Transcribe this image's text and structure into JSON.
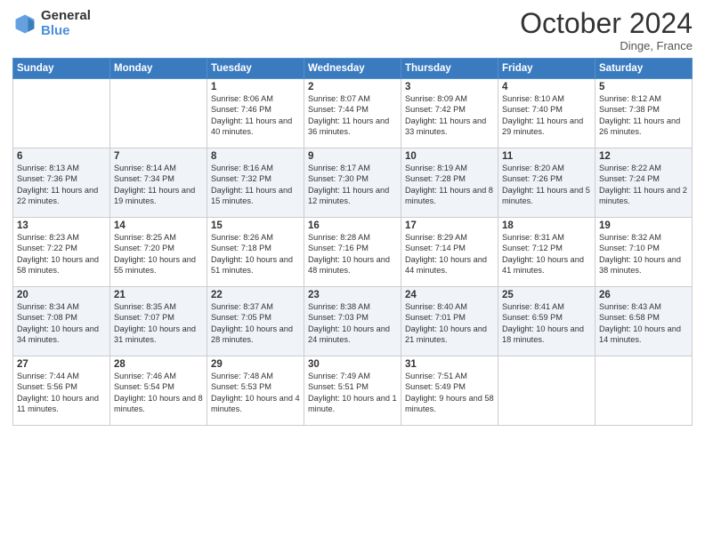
{
  "header": {
    "logo_general": "General",
    "logo_blue": "Blue",
    "month": "October 2024",
    "location": "Dinge, France"
  },
  "weekdays": [
    "Sunday",
    "Monday",
    "Tuesday",
    "Wednesday",
    "Thursday",
    "Friday",
    "Saturday"
  ],
  "weeks": [
    [
      {
        "day": "",
        "info": ""
      },
      {
        "day": "",
        "info": ""
      },
      {
        "day": "1",
        "info": "Sunrise: 8:06 AM\nSunset: 7:46 PM\nDaylight: 11 hours and 40 minutes."
      },
      {
        "day": "2",
        "info": "Sunrise: 8:07 AM\nSunset: 7:44 PM\nDaylight: 11 hours and 36 minutes."
      },
      {
        "day": "3",
        "info": "Sunrise: 8:09 AM\nSunset: 7:42 PM\nDaylight: 11 hours and 33 minutes."
      },
      {
        "day": "4",
        "info": "Sunrise: 8:10 AM\nSunset: 7:40 PM\nDaylight: 11 hours and 29 minutes."
      },
      {
        "day": "5",
        "info": "Sunrise: 8:12 AM\nSunset: 7:38 PM\nDaylight: 11 hours and 26 minutes."
      }
    ],
    [
      {
        "day": "6",
        "info": "Sunrise: 8:13 AM\nSunset: 7:36 PM\nDaylight: 11 hours and 22 minutes."
      },
      {
        "day": "7",
        "info": "Sunrise: 8:14 AM\nSunset: 7:34 PM\nDaylight: 11 hours and 19 minutes."
      },
      {
        "day": "8",
        "info": "Sunrise: 8:16 AM\nSunset: 7:32 PM\nDaylight: 11 hours and 15 minutes."
      },
      {
        "day": "9",
        "info": "Sunrise: 8:17 AM\nSunset: 7:30 PM\nDaylight: 11 hours and 12 minutes."
      },
      {
        "day": "10",
        "info": "Sunrise: 8:19 AM\nSunset: 7:28 PM\nDaylight: 11 hours and 8 minutes."
      },
      {
        "day": "11",
        "info": "Sunrise: 8:20 AM\nSunset: 7:26 PM\nDaylight: 11 hours and 5 minutes."
      },
      {
        "day": "12",
        "info": "Sunrise: 8:22 AM\nSunset: 7:24 PM\nDaylight: 11 hours and 2 minutes."
      }
    ],
    [
      {
        "day": "13",
        "info": "Sunrise: 8:23 AM\nSunset: 7:22 PM\nDaylight: 10 hours and 58 minutes."
      },
      {
        "day": "14",
        "info": "Sunrise: 8:25 AM\nSunset: 7:20 PM\nDaylight: 10 hours and 55 minutes."
      },
      {
        "day": "15",
        "info": "Sunrise: 8:26 AM\nSunset: 7:18 PM\nDaylight: 10 hours and 51 minutes."
      },
      {
        "day": "16",
        "info": "Sunrise: 8:28 AM\nSunset: 7:16 PM\nDaylight: 10 hours and 48 minutes."
      },
      {
        "day": "17",
        "info": "Sunrise: 8:29 AM\nSunset: 7:14 PM\nDaylight: 10 hours and 44 minutes."
      },
      {
        "day": "18",
        "info": "Sunrise: 8:31 AM\nSunset: 7:12 PM\nDaylight: 10 hours and 41 minutes."
      },
      {
        "day": "19",
        "info": "Sunrise: 8:32 AM\nSunset: 7:10 PM\nDaylight: 10 hours and 38 minutes."
      }
    ],
    [
      {
        "day": "20",
        "info": "Sunrise: 8:34 AM\nSunset: 7:08 PM\nDaylight: 10 hours and 34 minutes."
      },
      {
        "day": "21",
        "info": "Sunrise: 8:35 AM\nSunset: 7:07 PM\nDaylight: 10 hours and 31 minutes."
      },
      {
        "day": "22",
        "info": "Sunrise: 8:37 AM\nSunset: 7:05 PM\nDaylight: 10 hours and 28 minutes."
      },
      {
        "day": "23",
        "info": "Sunrise: 8:38 AM\nSunset: 7:03 PM\nDaylight: 10 hours and 24 minutes."
      },
      {
        "day": "24",
        "info": "Sunrise: 8:40 AM\nSunset: 7:01 PM\nDaylight: 10 hours and 21 minutes."
      },
      {
        "day": "25",
        "info": "Sunrise: 8:41 AM\nSunset: 6:59 PM\nDaylight: 10 hours and 18 minutes."
      },
      {
        "day": "26",
        "info": "Sunrise: 8:43 AM\nSunset: 6:58 PM\nDaylight: 10 hours and 14 minutes."
      }
    ],
    [
      {
        "day": "27",
        "info": "Sunrise: 7:44 AM\nSunset: 5:56 PM\nDaylight: 10 hours and 11 minutes."
      },
      {
        "day": "28",
        "info": "Sunrise: 7:46 AM\nSunset: 5:54 PM\nDaylight: 10 hours and 8 minutes."
      },
      {
        "day": "29",
        "info": "Sunrise: 7:48 AM\nSunset: 5:53 PM\nDaylight: 10 hours and 4 minutes."
      },
      {
        "day": "30",
        "info": "Sunrise: 7:49 AM\nSunset: 5:51 PM\nDaylight: 10 hours and 1 minute."
      },
      {
        "day": "31",
        "info": "Sunrise: 7:51 AM\nSunset: 5:49 PM\nDaylight: 9 hours and 58 minutes."
      },
      {
        "day": "",
        "info": ""
      },
      {
        "day": "",
        "info": ""
      }
    ]
  ]
}
